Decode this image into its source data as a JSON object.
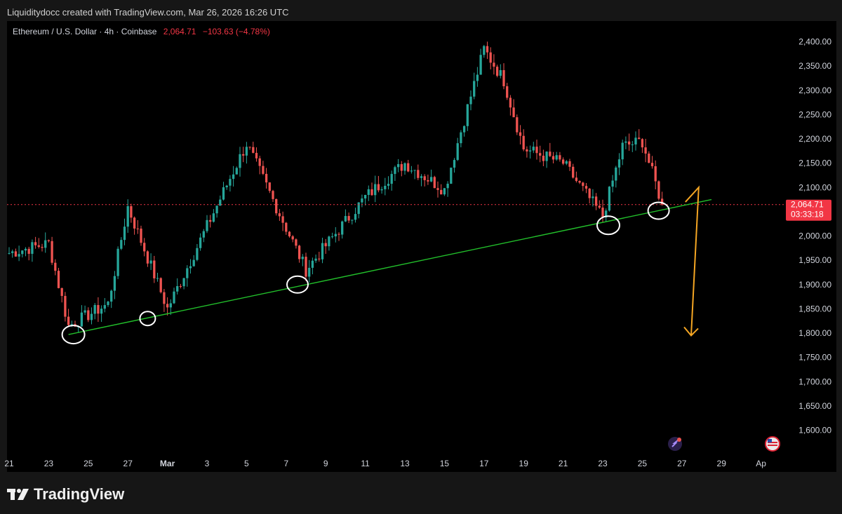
{
  "header": {
    "credit": "Liquiditydocc created with TradingView.com, Mar 26, 2026 16:26 UTC"
  },
  "legend": {
    "symbol": "Ethereum / U.S. Dollar · 4h · Coinbase",
    "price": "2,064.71",
    "change": "−103.63 (−4.78%)"
  },
  "price_tag": {
    "price": "2,064.71",
    "countdown": "03:33:18"
  },
  "footer": {
    "brand": "TradingView"
  },
  "colors": {
    "up": "#26a69a",
    "down": "#ef5350",
    "trendline": "#22c02b",
    "arrow": "#f5a623",
    "price_line": "#f23645",
    "circles": "#ffffff"
  },
  "chart_data": {
    "type": "candlestick",
    "symbol": "Ethereum / U.S. Dollar",
    "timeframe": "4h",
    "exchange": "Coinbase",
    "last_price": 2064.71,
    "ylim": [
      1580,
      2420
    ],
    "y_ticks": [
      "2,400.00",
      "2,350.00",
      "2,300.00",
      "2,250.00",
      "2,200.00",
      "2,150.00",
      "2,100.00",
      "2,050.00",
      "2,000.00",
      "1,950.00",
      "1,900.00",
      "1,850.00",
      "1,800.00",
      "1,750.00",
      "1,700.00",
      "1,650.00",
      "1,600.00"
    ],
    "x_ticks": [
      "21",
      "23",
      "25",
      "27",
      "Mar",
      "3",
      "5",
      "7",
      "9",
      "11",
      "13",
      "15",
      "17",
      "19",
      "21",
      "23",
      "25",
      "27",
      "29",
      "Ap"
    ],
    "key_prices": [
      {
        "x": "Feb 24",
        "y": 1815
      },
      {
        "x": "Feb 26",
        "y": 1860
      },
      {
        "x": "Feb 27",
        "y": 2060
      },
      {
        "x": "Mar 1",
        "y": 1850
      },
      {
        "x": "Mar 5",
        "y": 2190
      },
      {
        "x": "Mar 8",
        "y": 1930
      },
      {
        "x": "Mar 11",
        "y": 2080
      },
      {
        "x": "Mar 13",
        "y": 2150
      },
      {
        "x": "Mar 15",
        "y": 2095
      },
      {
        "x": "Mar 17",
        "y": 2385
      },
      {
        "x": "Mar 18",
        "y": 2320
      },
      {
        "x": "Mar 19",
        "y": 2180
      },
      {
        "x": "Mar 21",
        "y": 2150
      },
      {
        "x": "Mar 23",
        "y": 2040
      },
      {
        "x": "Mar 24",
        "y": 2185
      },
      {
        "x": "Mar 25",
        "y": 2195
      },
      {
        "x": "Mar 26",
        "y": 2064.71
      }
    ],
    "trendline": [
      {
        "x": "Feb 24",
        "y": 1797
      },
      {
        "x": "Mar 28",
        "y": 2075
      }
    ],
    "projection_arrow": [
      {
        "x": "Mar 27",
        "y": 2070
      },
      {
        "x": "Mar 27",
        "y": 2100
      },
      {
        "x": "Mar 28",
        "y": 1795
      }
    ],
    "marked_lows": [
      "Feb 24",
      "Feb 28",
      "Mar 8",
      "Mar 23",
      "Mar 26"
    ]
  }
}
